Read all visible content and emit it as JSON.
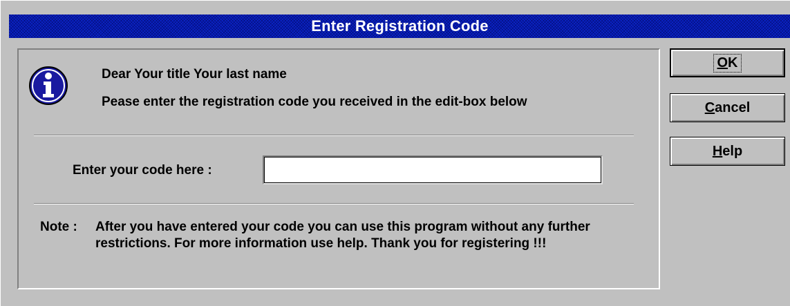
{
  "window": {
    "title": "Enter Registration Code"
  },
  "message": {
    "greeting": "Dear  Your title Your last name",
    "instruction": "Pease enter the registration code you received in the edit-box below"
  },
  "code_field": {
    "label": "Enter your code here :",
    "value": ""
  },
  "note": {
    "label": "Note :",
    "text": "After you have entered your code you can use this program without any further restrictions. For more information use help. Thank you for registering !!!"
  },
  "buttons": {
    "ok": {
      "label": "OK",
      "access_key": "O",
      "rest": "K"
    },
    "cancel": {
      "label": "Cancel",
      "access_key": "C",
      "rest": "ancel"
    },
    "help": {
      "label": "Help",
      "access_key": "H",
      "rest": "elp"
    }
  },
  "colors": {
    "titlebar": "#0a24c8",
    "face": "#c0c0c0",
    "icon_blue": "#1a1aa0"
  },
  "icons": {
    "info": "info-icon"
  }
}
